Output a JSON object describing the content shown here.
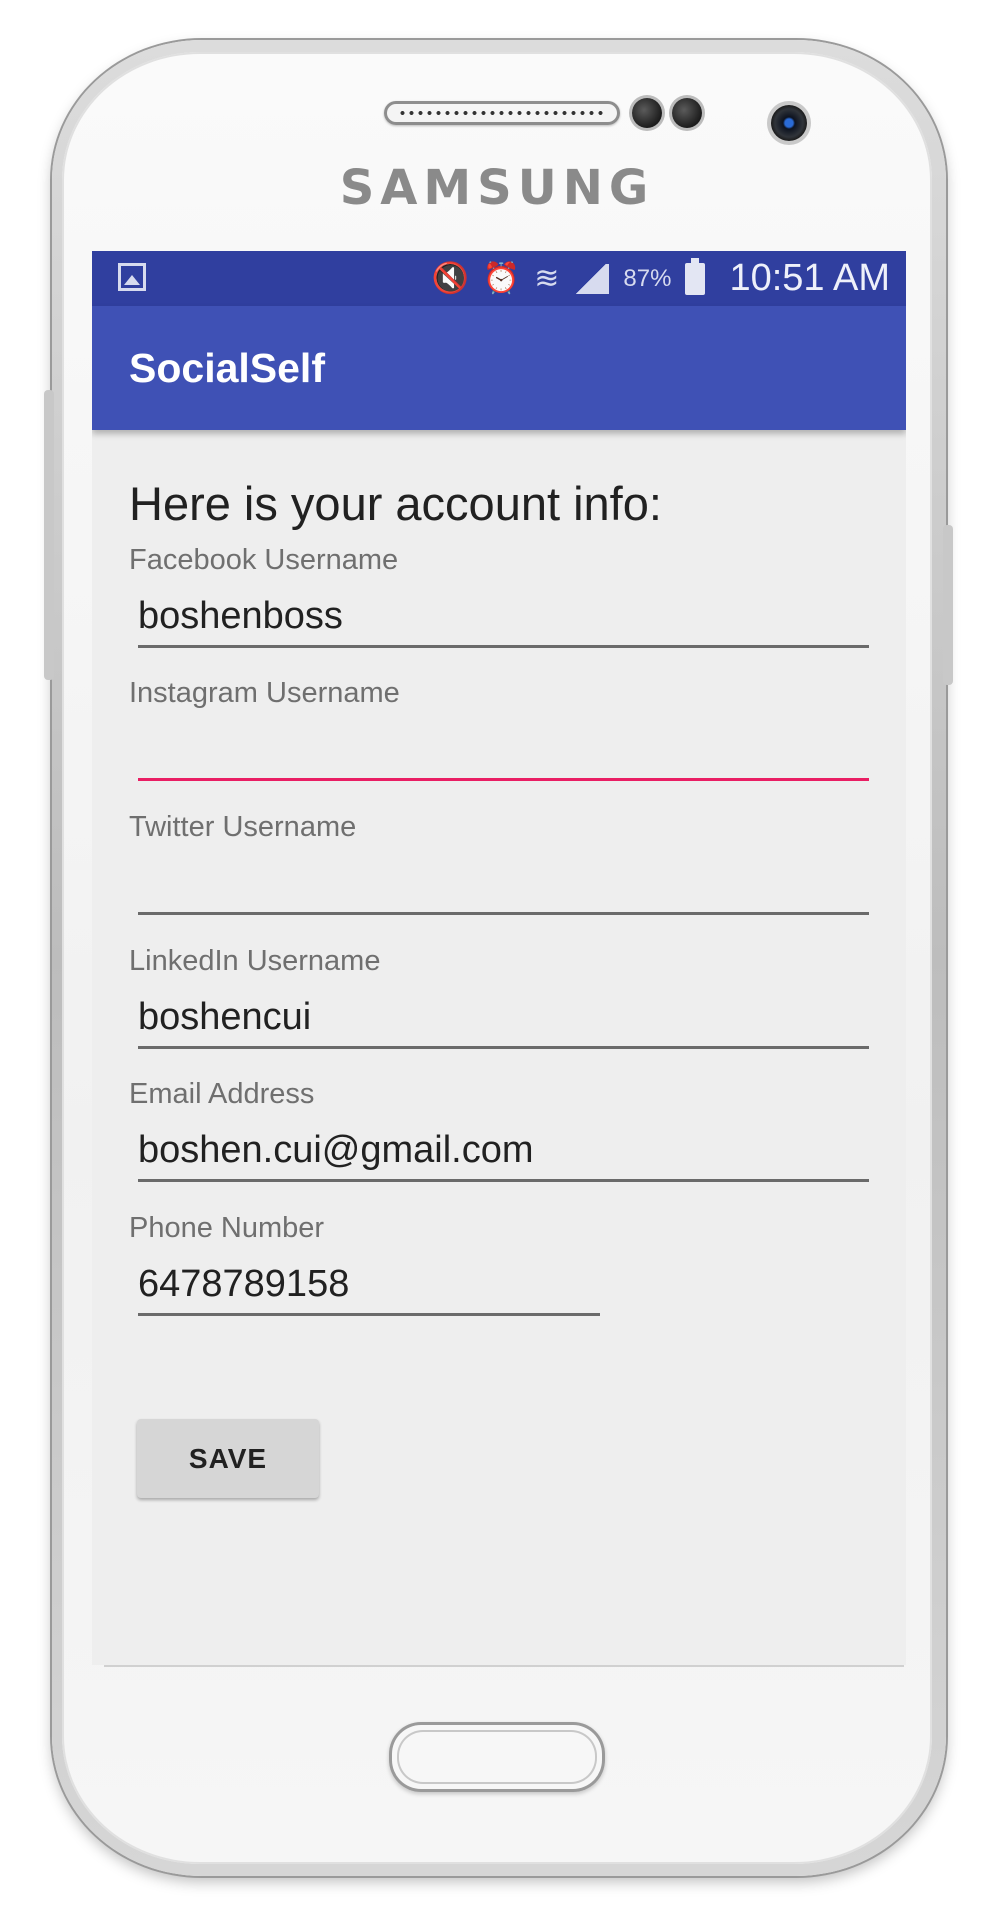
{
  "device": {
    "brand": "SAMSUNG"
  },
  "status_bar": {
    "battery_percent": "87%",
    "time": "10:51 AM",
    "icons": [
      "gallery-icon",
      "mute-icon",
      "alarm-icon",
      "wifi-icon",
      "signal-icon",
      "battery-icon"
    ]
  },
  "app_bar": {
    "title": "SocialSelf"
  },
  "form": {
    "heading": "Here is your account info:",
    "fields": [
      {
        "label": "Facebook Username",
        "value": "boshenboss",
        "focused": false
      },
      {
        "label": "Instagram Username",
        "value": "",
        "focused": true
      },
      {
        "label": "Twitter Username",
        "value": "",
        "focused": false
      },
      {
        "label": "LinkedIn Username",
        "value": "boshencui",
        "focused": false
      },
      {
        "label": "Email Address",
        "value": "boshen.cui@gmail.com",
        "focused": false
      },
      {
        "label": "Phone Number",
        "value": "6478789158",
        "focused": false
      }
    ],
    "save_label": "SAVE"
  },
  "colors": {
    "status_bar": "#303f9f",
    "app_bar": "#3f51b5",
    "accent": "#e91e63",
    "background": "#eeeeee"
  }
}
